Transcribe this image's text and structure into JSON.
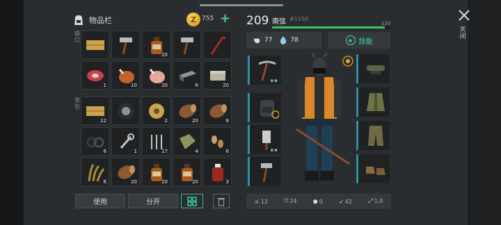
{
  "inventory": {
    "title": "物品栏",
    "coins": "755",
    "coin_symbol": "Z",
    "plus": "+",
    "section_quick": "袋口",
    "section_backpack": "背包",
    "quick_slots": [
      {
        "icon": "wood-planks-icon",
        "count": ""
      },
      {
        "icon": "hammer-icon",
        "count": ""
      },
      {
        "icon": "bottle-icon",
        "count": "20"
      },
      {
        "icon": "hammer-icon",
        "count": ""
      },
      {
        "icon": "crowbar-icon",
        "count": ""
      },
      {
        "icon": "raw-meat-icon",
        "count": "1"
      },
      {
        "icon": "roast-chicken-icon",
        "count": "10"
      },
      {
        "icon": "raw-chicken-icon",
        "count": "20"
      },
      {
        "icon": "metal-bar-icon",
        "count": "6"
      },
      {
        "icon": "stone-block-icon",
        "count": "20"
      }
    ],
    "backpack_slots": [
      {
        "icon": "wood-planks-icon",
        "count": "12"
      },
      {
        "icon": "tire-icon",
        "count": ""
      },
      {
        "icon": "rope-spool-icon",
        "count": "2"
      },
      {
        "icon": "log-icon",
        "count": "20"
      },
      {
        "icon": "log-icon",
        "count": "8"
      },
      {
        "icon": "coil-icon",
        "count": "6"
      },
      {
        "icon": "wrench-icon",
        "count": "1"
      },
      {
        "icon": "nails-icon",
        "count": "17"
      },
      {
        "icon": "cloth-icon",
        "count": "4"
      },
      {
        "icon": "seeds-icon",
        "count": "6"
      },
      {
        "icon": "grass-icon",
        "count": "6"
      },
      {
        "icon": "log-icon",
        "count": "20"
      },
      {
        "icon": "bottle-icon",
        "count": "20"
      },
      {
        "icon": "bottle-icon",
        "count": "20"
      },
      {
        "icon": "jar-icon",
        "count": "3"
      }
    ],
    "buttons": {
      "use": "使用",
      "split": "分开"
    }
  },
  "character": {
    "level": "209",
    "name": "南弦",
    "id": "#1150",
    "xp_max": "120",
    "xp_fraction": 0.95,
    "food": "77",
    "water": "78",
    "skills_label": "技能",
    "stats": {
      "attack": "12",
      "armor": "24",
      "defense": "0",
      "speed": "42",
      "multiplier": "1.0"
    }
  },
  "close_label": "关闭",
  "colors": {
    "accent": "#3fe0a8",
    "xp": "#3fc169",
    "slot_border": "#2f8fa4"
  }
}
